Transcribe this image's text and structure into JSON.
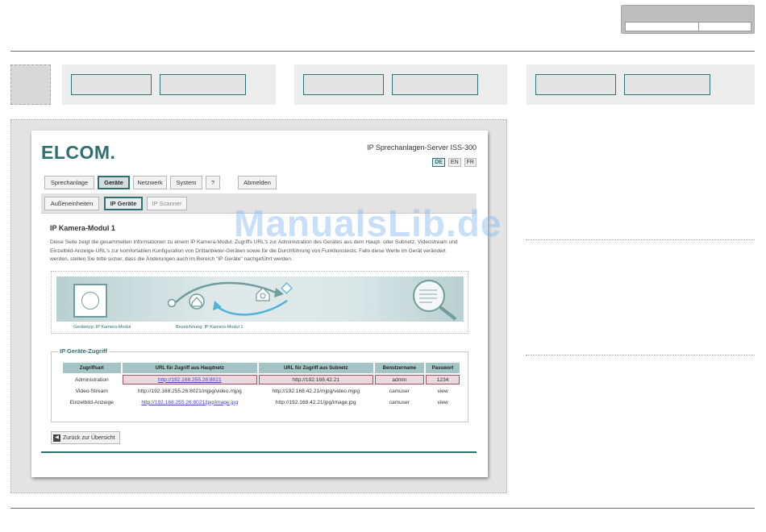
{
  "watermark": "ManualsLib.de",
  "app": {
    "logo": "ELCOM.",
    "product_title": "IP Sprechanlagen-Server ISS-300",
    "languages": [
      "DE",
      "EN",
      "FR"
    ],
    "active_language": "DE"
  },
  "main_tabs": [
    {
      "label": "Sprechanlage",
      "active": false
    },
    {
      "label": "Geräte",
      "active": true
    },
    {
      "label": "Netzwerk",
      "active": false
    },
    {
      "label": "System",
      "active": false
    },
    {
      "label": "?",
      "active": false
    },
    {
      "label": "Abmelden",
      "active": false
    }
  ],
  "sub_tabs": [
    {
      "label": "Außeneinheiten",
      "active": false
    },
    {
      "label": "IP Geräte",
      "active": true
    },
    {
      "label": "IP Scanner",
      "active": false
    }
  ],
  "page": {
    "heading": "IP Kamera-Modul 1",
    "description": "Diese Seite zeigt die gesammelten Informationen zu einem IP Kamera-Modul: Zugriffs URL's zur Administration des Gerätes aus dem Haupt- oder Subnetz, Videostream und Einzelbild-Anzeige-URL's zur komfortablen Konfiguration von Drittanbieter-Geräten sowie für die Durchführung von Funktionstests. Falls diese Werte im Gerät verändert werden, stellen Sie bitte sicher, dass die Änderungen auch im Bereich \"IP Geräte\" nachgeführt werden."
  },
  "device": {
    "type_caption": "Gerätetyp: IP Kamera-Modul",
    "name_caption": "Bezeichnung: IP Kamera-Modul 1"
  },
  "access": {
    "title": "IP Geräte-Zugriff",
    "columns": [
      "Zugriffsart",
      "URL für Zugriff aus Hauptnetz",
      "URL für Zugriff aus Subnetz",
      "Benutzername",
      "Passwort"
    ],
    "rows": [
      {
        "type": "Administration",
        "main_url": "http://192.168.255.26:8021",
        "sub_url": "http://192.168.42.21",
        "user": "admin",
        "password": "1234"
      },
      {
        "type": "Video-Stream",
        "main_url": "http://192.168.255.26:8021/mjpg/video.mjpg",
        "sub_url": "http://192.168.42.21/mjpg/video.mjpg",
        "user": "camuser",
        "password": "view"
      },
      {
        "type": "Einzelbild-Anzeige",
        "main_url": "http://192.168.255.26:8021/jpg/image.jpg",
        "sub_url": "http://192.168.42.21/jpg/image.jpg",
        "user": "camuser",
        "password": "view"
      }
    ]
  },
  "back_button": "Zurück zur Übersicht"
}
